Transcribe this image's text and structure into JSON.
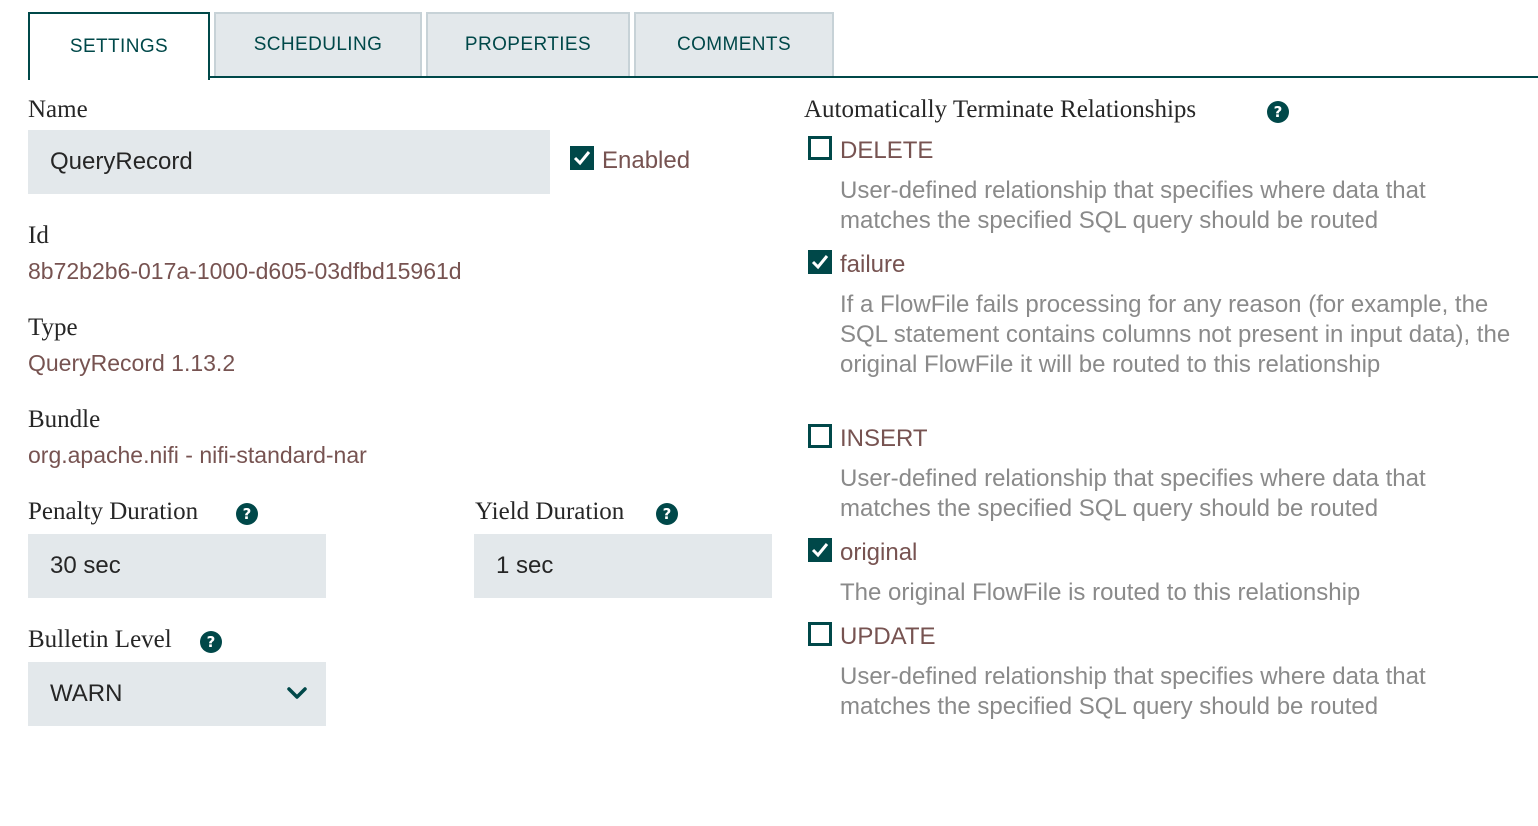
{
  "tabs": [
    {
      "label": "SETTINGS",
      "active": true
    },
    {
      "label": "SCHEDULING",
      "active": false
    },
    {
      "label": "PROPERTIES",
      "active": false
    },
    {
      "label": "COMMENTS",
      "active": false
    }
  ],
  "settings": {
    "name_label": "Name",
    "name_value": "QueryRecord",
    "enabled_label": "Enabled",
    "enabled_checked": true,
    "id_label": "Id",
    "id_value": "8b72b2b6-017a-1000-d605-03dfbd15961d",
    "type_label": "Type",
    "type_value": "QueryRecord 1.13.2",
    "bundle_label": "Bundle",
    "bundle_value": "org.apache.nifi - nifi-standard-nar",
    "penalty_label": "Penalty Duration",
    "penalty_value": "30 sec",
    "yield_label": "Yield Duration",
    "yield_value": "1 sec",
    "bulletin_label": "Bulletin Level",
    "bulletin_value": "WARN",
    "help_glyph": "?"
  },
  "relationships": {
    "title": "Automatically Terminate Relationships",
    "items": [
      {
        "name": "DELETE",
        "checked": false,
        "description": "User-defined relationship that specifies where data that matches the specified SQL query should be routed"
      },
      {
        "name": "failure",
        "checked": true,
        "description": "If a FlowFile fails processing for any reason (for example, the SQL statement contains columns not present in input data), the original FlowFile it will be routed to this relationship"
      },
      {
        "name": "INSERT",
        "checked": false,
        "description": "User-defined relationship that specifies where data that matches the specified SQL query should be routed"
      },
      {
        "name": "original",
        "checked": true,
        "description": "The original FlowFile is routed to this relationship"
      },
      {
        "name": "UPDATE",
        "checked": false,
        "description": "User-defined relationship that specifies where data that matches the specified SQL query should be routed"
      }
    ]
  },
  "colors": {
    "accent": "#004849",
    "value_text": "#775351",
    "field_bg": "#e3e8eb",
    "description_text": "#8a8a8a"
  }
}
